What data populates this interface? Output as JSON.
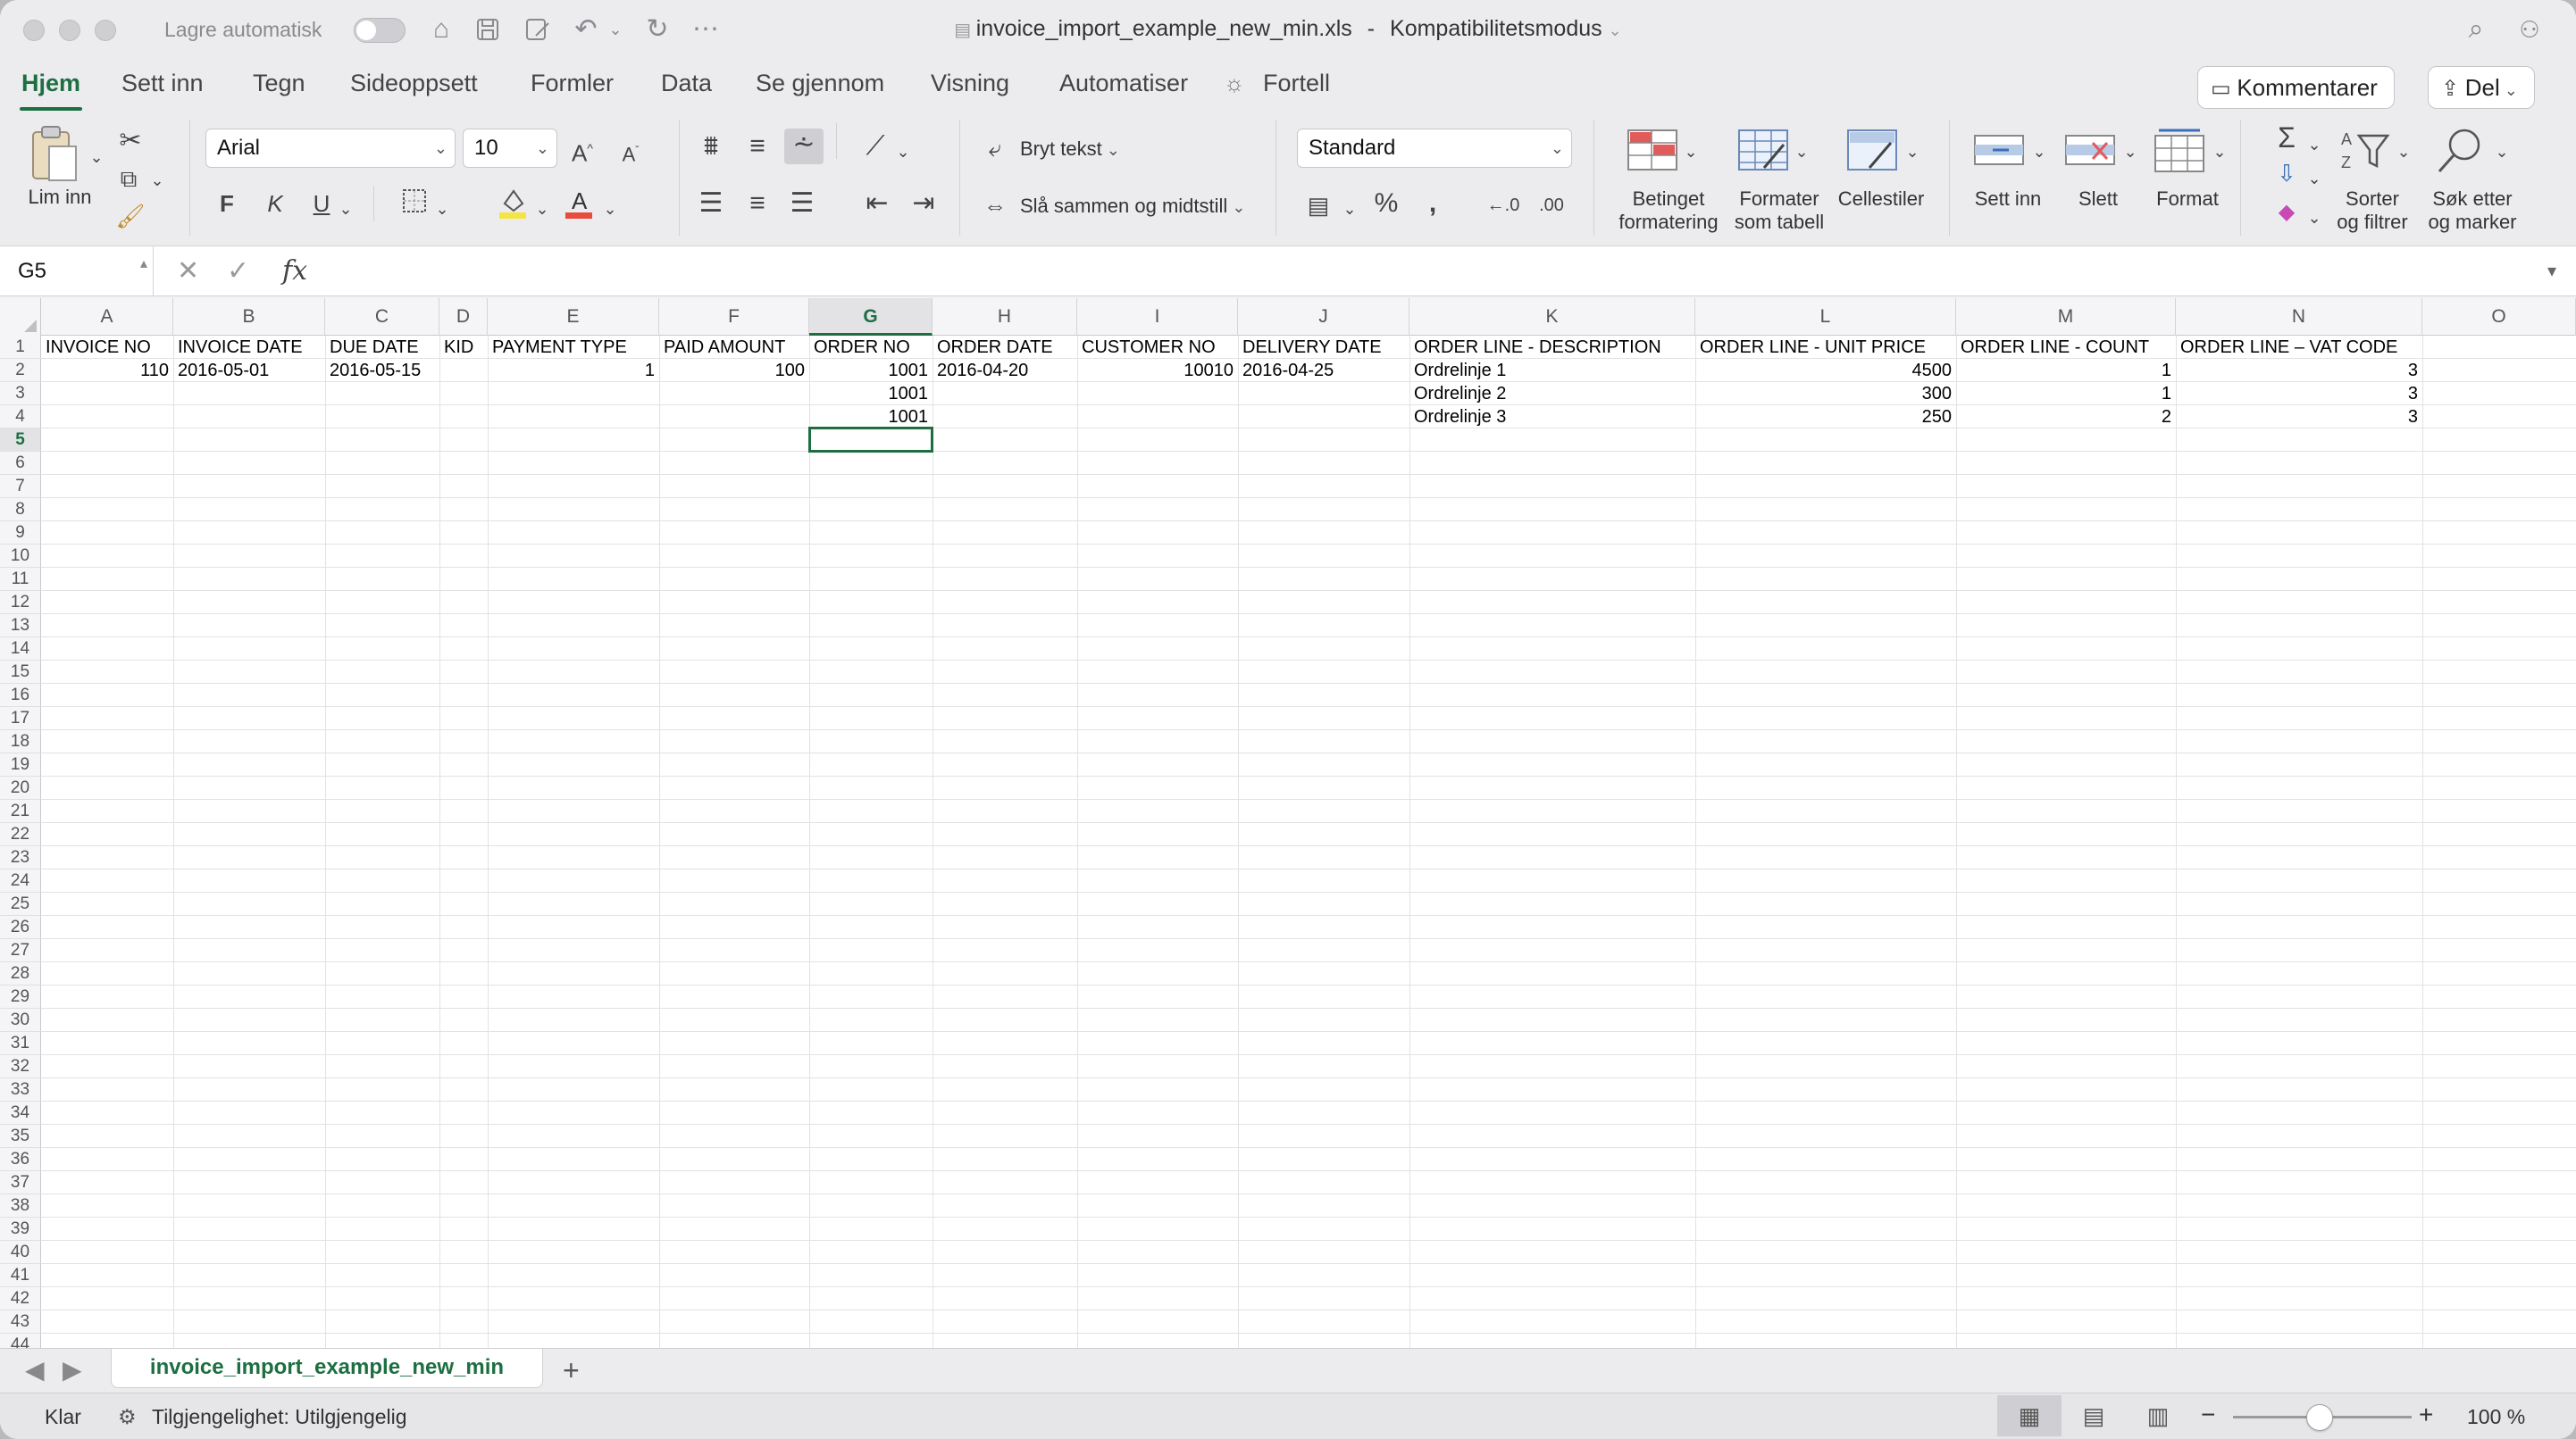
{
  "titlebar": {
    "autosave_label": "Lagre automatisk",
    "file_name": "invoice_import_example_new_min.xls",
    "separator": "-",
    "mode": "Kompatibilitetsmodus"
  },
  "tabs": [
    "Hjem",
    "Sett inn",
    "Tegn",
    "Sideoppsett",
    "Formler",
    "Data",
    "Se gjennom",
    "Visning",
    "Automatiser",
    "Fortell"
  ],
  "actions": {
    "comments": "Kommentarer",
    "share": "Del"
  },
  "ribbon": {
    "paste": "Lim inn",
    "font_name": "Arial",
    "font_size": "10",
    "bold": "F",
    "italic": "K",
    "underline": "U",
    "wrap_text": "Bryt tekst",
    "merge_center": "Slå sammen og midtstill",
    "number_format": "Standard",
    "conditional_formatting": [
      "Betinget",
      "formatering"
    ],
    "format_as_table": [
      "Formater",
      "som tabell"
    ],
    "cell_styles": "Cellestiler",
    "insert": "Sett inn",
    "delete": "Slett",
    "format": "Format",
    "sort_filter": [
      "Sorter",
      "og filtrer"
    ],
    "find_select": [
      "Søk etter",
      "og marker"
    ]
  },
  "formula_bar": {
    "name_box": "G5",
    "fx": "fx",
    "value": ""
  },
  "sheet": {
    "columns": [
      "A",
      "B",
      "C",
      "D",
      "E",
      "F",
      "G",
      "H",
      "I",
      "J",
      "K",
      "L",
      "M",
      "N",
      "O"
    ],
    "selected_column": "G",
    "selected_row": 5,
    "row_count": 44,
    "rows": [
      [
        "INVOICE NO",
        "INVOICE DATE",
        "DUE DATE",
        "KID",
        "PAYMENT TYPE",
        "PAID AMOUNT",
        "ORDER NO",
        "ORDER DATE",
        "CUSTOMER NO",
        "DELIVERY DATE",
        "ORDER LINE - DESCRIPTION",
        "ORDER LINE - UNIT PRICE",
        "ORDER LINE - COUNT",
        "ORDER LINE – VAT CODE",
        ""
      ],
      [
        "110",
        "2016-05-01",
        "2016-05-15",
        "",
        "1",
        "100",
        "1001",
        "2016-04-20",
        "10010",
        "2016-04-25",
        "Ordrelinje 1",
        "4500",
        "1",
        "3",
        ""
      ],
      [
        "",
        "",
        "",
        "",
        "",
        "",
        "1001",
        "",
        "",
        "",
        "Ordrelinje 2",
        "300",
        "1",
        "3",
        ""
      ],
      [
        "",
        "",
        "",
        "",
        "",
        "",
        "1001",
        "",
        "",
        "",
        "Ordrelinje 3",
        "250",
        "2",
        "3",
        ""
      ]
    ],
    "numeric_columns": [
      0,
      4,
      5,
      6,
      8,
      11,
      12,
      13
    ]
  },
  "sheet_tabs": {
    "active": "invoice_import_example_new_min",
    "add": "+"
  },
  "status": {
    "ready": "Klar",
    "accessibility": "Tilgjengelighet: Utilgjengelig",
    "zoom": "100 %",
    "zoom_minus": "−",
    "zoom_plus": "+"
  },
  "colors": {
    "accent": "#1d6f42"
  }
}
